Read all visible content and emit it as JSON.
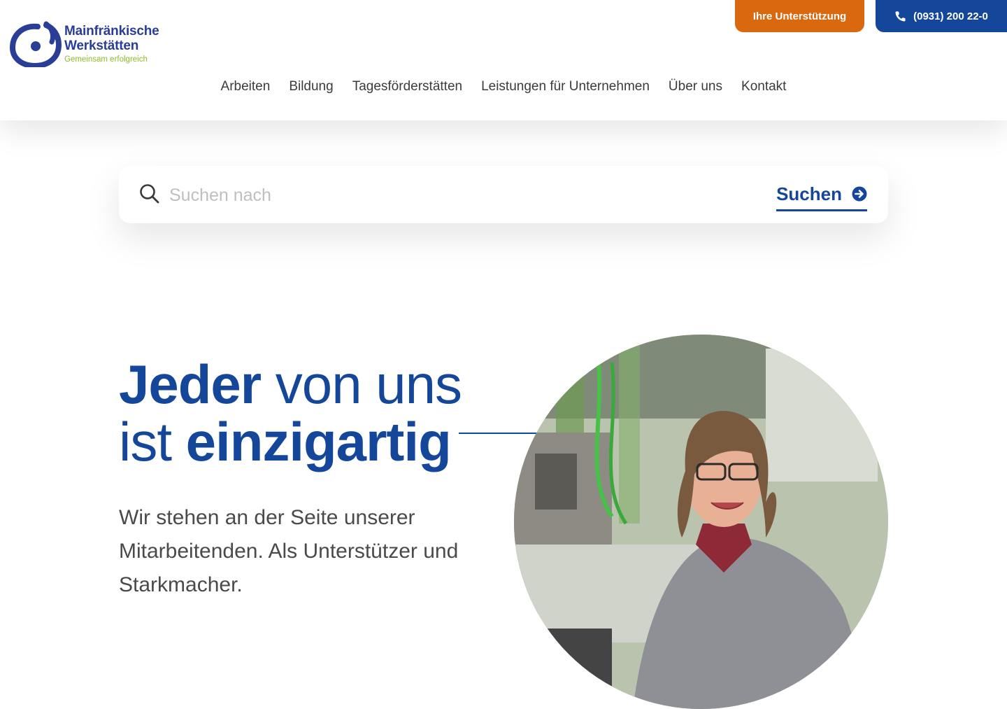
{
  "header": {
    "logo": {
      "line1": "Mainfränkische",
      "line2": "Werkstätten",
      "tagline": "Gemeinsam erfolgreich"
    },
    "support_button": "Ihre Unterstützung",
    "phone_button": "(0931) 200 22-0",
    "nav": [
      "Arbeiten",
      "Bildung",
      "Tagesförderstätten",
      "Leistungen für Unternehmen",
      "Über uns",
      "Kontakt"
    ]
  },
  "search": {
    "placeholder": "Suchen nach",
    "value": "",
    "button_label": "Suchen"
  },
  "hero": {
    "title_part1_bold": "Jeder",
    "title_part2": " von uns",
    "title_part3": "ist ",
    "title_part4_bold": "einzigartig",
    "subtitle": "Wir stehen an der Seite unserer Mitarbeitenden. Als Unterstützer und Starkmacher."
  },
  "colors": {
    "brand_blue": "#14479a",
    "logo_blue": "#2a3e96",
    "orange": "#d9680f",
    "green": "#8dbb25"
  },
  "icons": [
    "logo-mark-icon",
    "phone-icon",
    "search-icon",
    "arrow-right-circle-icon"
  ]
}
